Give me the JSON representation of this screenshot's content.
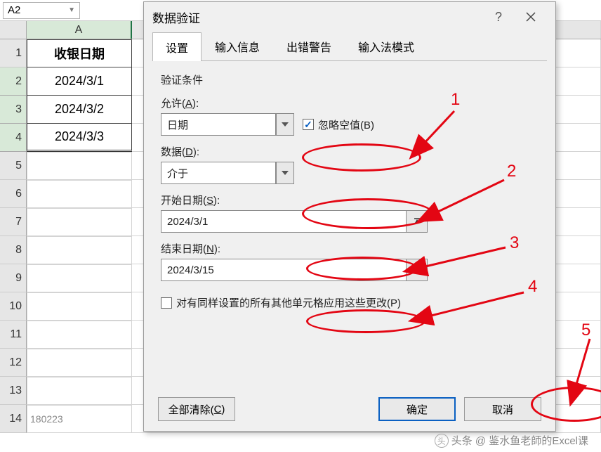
{
  "namebox": {
    "value": "A2"
  },
  "columns": {
    "A": "A"
  },
  "rows": {
    "header": "收银日期",
    "data": [
      "2024/3/1",
      "2024/3/2",
      "2024/3/3"
    ],
    "numbers": [
      "1",
      "2",
      "3",
      "4",
      "5",
      "6",
      "7",
      "8",
      "9",
      "10",
      "11",
      "12",
      "13",
      "14"
    ]
  },
  "dialog": {
    "title": "数据验证",
    "help": "?",
    "tabs": {
      "settings": "设置",
      "input_msg": "输入信息",
      "error_alert": "出错警告",
      "ime_mode": "输入法模式"
    },
    "section": "验证条件",
    "allow": {
      "label_pre": "允许(",
      "key": "A",
      "label_post": "):",
      "value": "日期"
    },
    "ignore_blank": {
      "label_pre": "忽略空值(",
      "key": "B",
      "label_post": ")",
      "checked": true
    },
    "data": {
      "label_pre": "数据(",
      "key": "D",
      "label_post": "):",
      "value": "介于"
    },
    "start": {
      "label_pre": "开始日期(",
      "key": "S",
      "label_post": "):",
      "value": "2024/3/1"
    },
    "end": {
      "label_pre": "结束日期(",
      "key": "N",
      "label_post": "):",
      "value": "2024/3/15"
    },
    "apply_all": {
      "label_pre": "对有同样设置的所有其他单元格应用这些更改(",
      "key": "P",
      "label_post": ")"
    },
    "clear_all": {
      "label_pre": "全部清除(",
      "key": "C",
      "label_post": ")"
    },
    "ok": "确定",
    "cancel": "取消"
  },
  "annotations": {
    "n1": "1",
    "n2": "2",
    "n3": "3",
    "n4": "4",
    "n5": "5"
  },
  "watermark": "头条 @ 鉴水鱼老師的Excel课",
  "partial_row14": "180223"
}
